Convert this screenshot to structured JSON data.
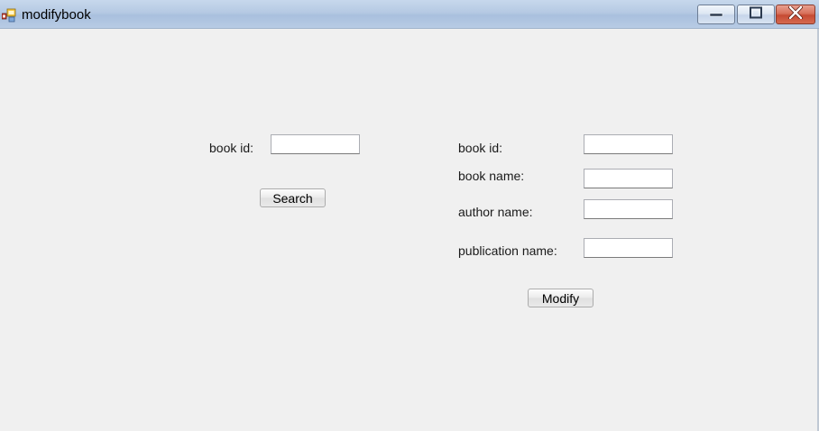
{
  "window": {
    "title": "modifybook",
    "icon": "form-app-icon",
    "caption_buttons": [
      "minimize-icon",
      "maximize-icon",
      "close-icon"
    ]
  },
  "search_panel": {
    "book_id_label": "book id:",
    "book_id_value": "",
    "search_button": "Search"
  },
  "modify_panel": {
    "book_id_label": "book id:",
    "book_id_value": "",
    "book_name_label": "book name:",
    "book_name_value": "",
    "author_name_label": "author name:",
    "author_name_value": "",
    "publication_name_label": "publication name:",
    "publication_name_value": "",
    "modify_button": "Modify"
  },
  "colors": {
    "form_background": "#f0f0f0",
    "titlebar": "#b5c9e3",
    "close_button": "#c64a33"
  }
}
